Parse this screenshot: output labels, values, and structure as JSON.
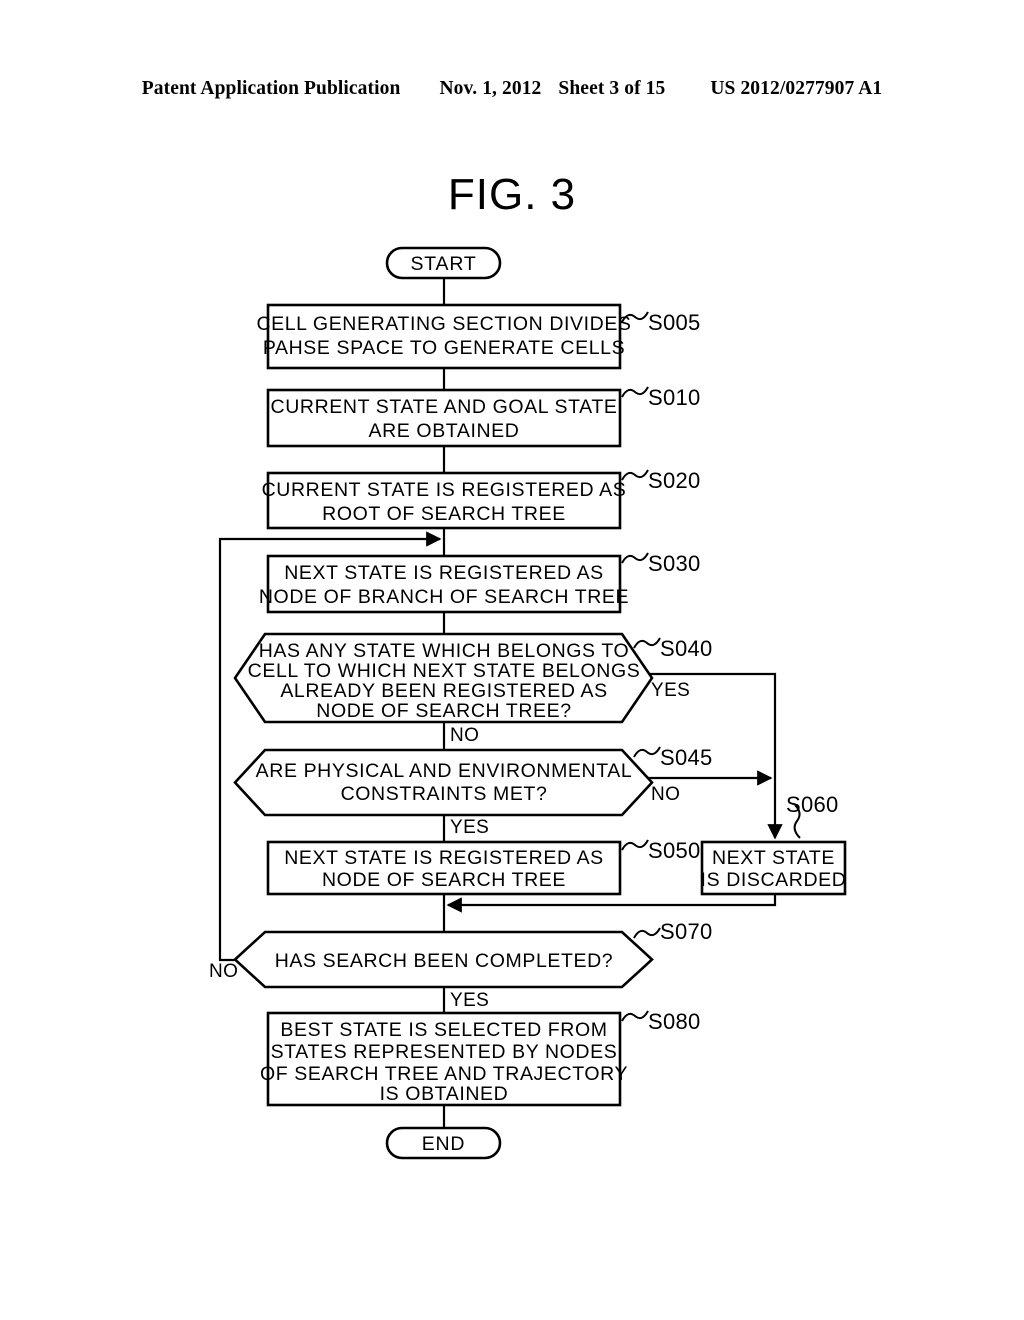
{
  "header": {
    "publication": "Patent Application Publication",
    "date": "Nov. 1, 2012",
    "sheet": "Sheet 3 of 15",
    "number": "US 2012/0277907 A1"
  },
  "figure": {
    "title": "FIG. 3"
  },
  "flowchart": {
    "start": {
      "label": "START"
    },
    "end": {
      "label": "END"
    },
    "steps": [
      {
        "id": "S005",
        "shape": "process",
        "lines": [
          "CELL GENERATING SECTION DIVIDES",
          "PAHSE SPACE TO GENERATE CELLS"
        ]
      },
      {
        "id": "S010",
        "shape": "process",
        "lines": [
          "CURRENT STATE AND GOAL STATE",
          "ARE OBTAINED"
        ]
      },
      {
        "id": "S020",
        "shape": "process",
        "lines": [
          "CURRENT STATE IS REGISTERED AS",
          "ROOT OF SEARCH TREE"
        ]
      },
      {
        "id": "S030",
        "shape": "process",
        "lines": [
          "NEXT STATE IS REGISTERED AS",
          "NODE OF BRANCH OF SEARCH TREE"
        ]
      },
      {
        "id": "S040",
        "shape": "decision",
        "lines": [
          "HAS ANY STATE WHICH BELONGS TO",
          "CELL TO WHICH NEXT STATE BELONGS",
          "ALREADY BEEN REGISTERED AS",
          "NODE OF SEARCH TREE?"
        ],
        "yes_label": "YES",
        "no_label": "NO"
      },
      {
        "id": "S045",
        "shape": "decision",
        "lines": [
          "ARE PHYSICAL AND ENVIRONMENTAL",
          "CONSTRAINTS MET?"
        ],
        "yes_label": "YES",
        "no_label": "NO"
      },
      {
        "id": "S050",
        "shape": "process",
        "lines": [
          "NEXT STATE IS REGISTERED AS",
          "NODE OF SEARCH TREE"
        ]
      },
      {
        "id": "S060",
        "shape": "process",
        "lines": [
          "NEXT STATE",
          "IS DISCARDED"
        ]
      },
      {
        "id": "S070",
        "shape": "decision",
        "lines": [
          "HAS SEARCH BEEN COMPLETED?"
        ],
        "yes_label": "YES",
        "no_label": "NO"
      },
      {
        "id": "S080",
        "shape": "process",
        "lines": [
          "BEST STATE IS SELECTED FROM",
          "STATES REPRESENTED BY NODES",
          "OF SEARCH TREE AND TRAJECTORY",
          "IS OBTAINED"
        ]
      }
    ]
  },
  "colors": {
    "ink": "#000000",
    "paper": "#ffffff"
  }
}
